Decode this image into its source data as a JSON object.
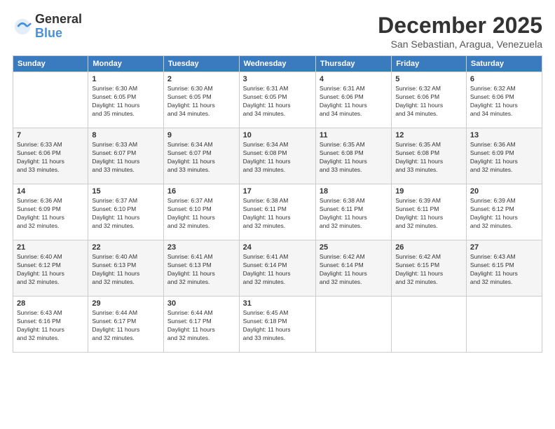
{
  "header": {
    "logo_general": "General",
    "logo_blue": "Blue",
    "title": "December 2025",
    "location": "San Sebastian, Aragua, Venezuela"
  },
  "days_of_week": [
    "Sunday",
    "Monday",
    "Tuesday",
    "Wednesday",
    "Thursday",
    "Friday",
    "Saturday"
  ],
  "weeks": [
    [
      {
        "day": "",
        "info": ""
      },
      {
        "day": "1",
        "info": "Sunrise: 6:30 AM\nSunset: 6:05 PM\nDaylight: 11 hours\nand 35 minutes."
      },
      {
        "day": "2",
        "info": "Sunrise: 6:30 AM\nSunset: 6:05 PM\nDaylight: 11 hours\nand 34 minutes."
      },
      {
        "day": "3",
        "info": "Sunrise: 6:31 AM\nSunset: 6:05 PM\nDaylight: 11 hours\nand 34 minutes."
      },
      {
        "day": "4",
        "info": "Sunrise: 6:31 AM\nSunset: 6:06 PM\nDaylight: 11 hours\nand 34 minutes."
      },
      {
        "day": "5",
        "info": "Sunrise: 6:32 AM\nSunset: 6:06 PM\nDaylight: 11 hours\nand 34 minutes."
      },
      {
        "day": "6",
        "info": "Sunrise: 6:32 AM\nSunset: 6:06 PM\nDaylight: 11 hours\nand 34 minutes."
      }
    ],
    [
      {
        "day": "7",
        "info": "Sunrise: 6:33 AM\nSunset: 6:06 PM\nDaylight: 11 hours\nand 33 minutes."
      },
      {
        "day": "8",
        "info": "Sunrise: 6:33 AM\nSunset: 6:07 PM\nDaylight: 11 hours\nand 33 minutes."
      },
      {
        "day": "9",
        "info": "Sunrise: 6:34 AM\nSunset: 6:07 PM\nDaylight: 11 hours\nand 33 minutes."
      },
      {
        "day": "10",
        "info": "Sunrise: 6:34 AM\nSunset: 6:08 PM\nDaylight: 11 hours\nand 33 minutes."
      },
      {
        "day": "11",
        "info": "Sunrise: 6:35 AM\nSunset: 6:08 PM\nDaylight: 11 hours\nand 33 minutes."
      },
      {
        "day": "12",
        "info": "Sunrise: 6:35 AM\nSunset: 6:08 PM\nDaylight: 11 hours\nand 33 minutes."
      },
      {
        "day": "13",
        "info": "Sunrise: 6:36 AM\nSunset: 6:09 PM\nDaylight: 11 hours\nand 32 minutes."
      }
    ],
    [
      {
        "day": "14",
        "info": "Sunrise: 6:36 AM\nSunset: 6:09 PM\nDaylight: 11 hours\nand 32 minutes."
      },
      {
        "day": "15",
        "info": "Sunrise: 6:37 AM\nSunset: 6:10 PM\nDaylight: 11 hours\nand 32 minutes."
      },
      {
        "day": "16",
        "info": "Sunrise: 6:37 AM\nSunset: 6:10 PM\nDaylight: 11 hours\nand 32 minutes."
      },
      {
        "day": "17",
        "info": "Sunrise: 6:38 AM\nSunset: 6:11 PM\nDaylight: 11 hours\nand 32 minutes."
      },
      {
        "day": "18",
        "info": "Sunrise: 6:38 AM\nSunset: 6:11 PM\nDaylight: 11 hours\nand 32 minutes."
      },
      {
        "day": "19",
        "info": "Sunrise: 6:39 AM\nSunset: 6:11 PM\nDaylight: 11 hours\nand 32 minutes."
      },
      {
        "day": "20",
        "info": "Sunrise: 6:39 AM\nSunset: 6:12 PM\nDaylight: 11 hours\nand 32 minutes."
      }
    ],
    [
      {
        "day": "21",
        "info": "Sunrise: 6:40 AM\nSunset: 6:12 PM\nDaylight: 11 hours\nand 32 minutes."
      },
      {
        "day": "22",
        "info": "Sunrise: 6:40 AM\nSunset: 6:13 PM\nDaylight: 11 hours\nand 32 minutes."
      },
      {
        "day": "23",
        "info": "Sunrise: 6:41 AM\nSunset: 6:13 PM\nDaylight: 11 hours\nand 32 minutes."
      },
      {
        "day": "24",
        "info": "Sunrise: 6:41 AM\nSunset: 6:14 PM\nDaylight: 11 hours\nand 32 minutes."
      },
      {
        "day": "25",
        "info": "Sunrise: 6:42 AM\nSunset: 6:14 PM\nDaylight: 11 hours\nand 32 minutes."
      },
      {
        "day": "26",
        "info": "Sunrise: 6:42 AM\nSunset: 6:15 PM\nDaylight: 11 hours\nand 32 minutes."
      },
      {
        "day": "27",
        "info": "Sunrise: 6:43 AM\nSunset: 6:15 PM\nDaylight: 11 hours\nand 32 minutes."
      }
    ],
    [
      {
        "day": "28",
        "info": "Sunrise: 6:43 AM\nSunset: 6:16 PM\nDaylight: 11 hours\nand 32 minutes."
      },
      {
        "day": "29",
        "info": "Sunrise: 6:44 AM\nSunset: 6:17 PM\nDaylight: 11 hours\nand 32 minutes."
      },
      {
        "day": "30",
        "info": "Sunrise: 6:44 AM\nSunset: 6:17 PM\nDaylight: 11 hours\nand 32 minutes."
      },
      {
        "day": "31",
        "info": "Sunrise: 6:45 AM\nSunset: 6:18 PM\nDaylight: 11 hours\nand 33 minutes."
      },
      {
        "day": "",
        "info": ""
      },
      {
        "day": "",
        "info": ""
      },
      {
        "day": "",
        "info": ""
      }
    ]
  ]
}
